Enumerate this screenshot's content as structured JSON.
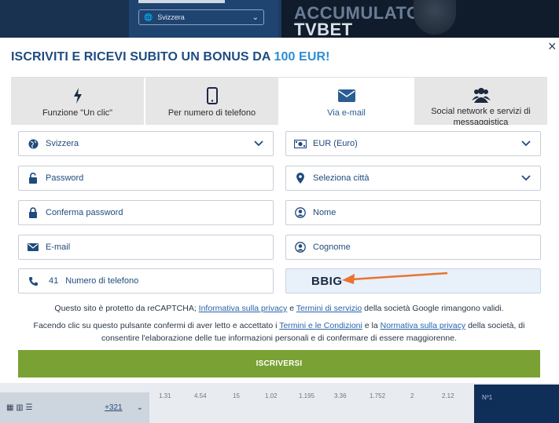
{
  "background": {
    "country_select": "Svizzera",
    "banner_line1": "ACCUMULATORE",
    "banner_line2": "TVBET",
    "bottom_counter": "+321",
    "odds": [
      "1.31",
      "4.54",
      "15",
      "1.02",
      "1.195",
      "3.36",
      "1.752",
      "2",
      "2.12"
    ],
    "right_label": "Nº1"
  },
  "modal": {
    "title_prefix": "ISCRIVITI E RICEVI SUBITO UN BONUS DA ",
    "title_amount": "100 EUR!",
    "close_label": "×",
    "tabs": [
      {
        "label": "Funzione \"Un clic\"",
        "icon": "lightning-icon"
      },
      {
        "label": "Per numero di telefono",
        "icon": "mobile-phone-icon"
      },
      {
        "label": "Via e-mail",
        "icon": "envelope-icon",
        "active": true
      },
      {
        "label": "Social network e servizi di messaggistica",
        "icon": "users-icon"
      }
    ],
    "fields": {
      "country": "Svizzera",
      "currency": "EUR (Euro)",
      "password_placeholder": "Password",
      "city": "Seleziona città",
      "confirm_password_placeholder": "Conferma password",
      "first_name_placeholder": "Nome",
      "email_placeholder": "E-mail",
      "last_name_placeholder": "Cognome",
      "phone_code": "41",
      "phone_placeholder": "Numero di telefono",
      "captcha": "BBIG"
    },
    "recaptcha": {
      "part1": "Questo sito è protetto da reCAPTCHA; ",
      "privacy_link": "Informativa sulla privacy",
      "part2": " e ",
      "terms_link": "Termini di servizio",
      "part3": " della società Google rimangono validi."
    },
    "consent": {
      "part1": "Facendo clic su questo pulsante confermi di aver letto e accettato i ",
      "terms_link": "Termini e le Condizioni",
      "part2": " e la ",
      "privacy_link": "Normativa sulla privacy",
      "part3": " della società, di",
      "line2": "consentire l'elaborazione delle tue informazioni personali e di confermare di essere maggiorenne."
    },
    "submit_label": "ISCRIVERSI"
  },
  "colors": {
    "title": "#1e4c80",
    "accent": "#2d8ed6",
    "icon": "#1f4b7d",
    "submit": "#7aa133",
    "annotation_arrow": "#e8742e"
  }
}
